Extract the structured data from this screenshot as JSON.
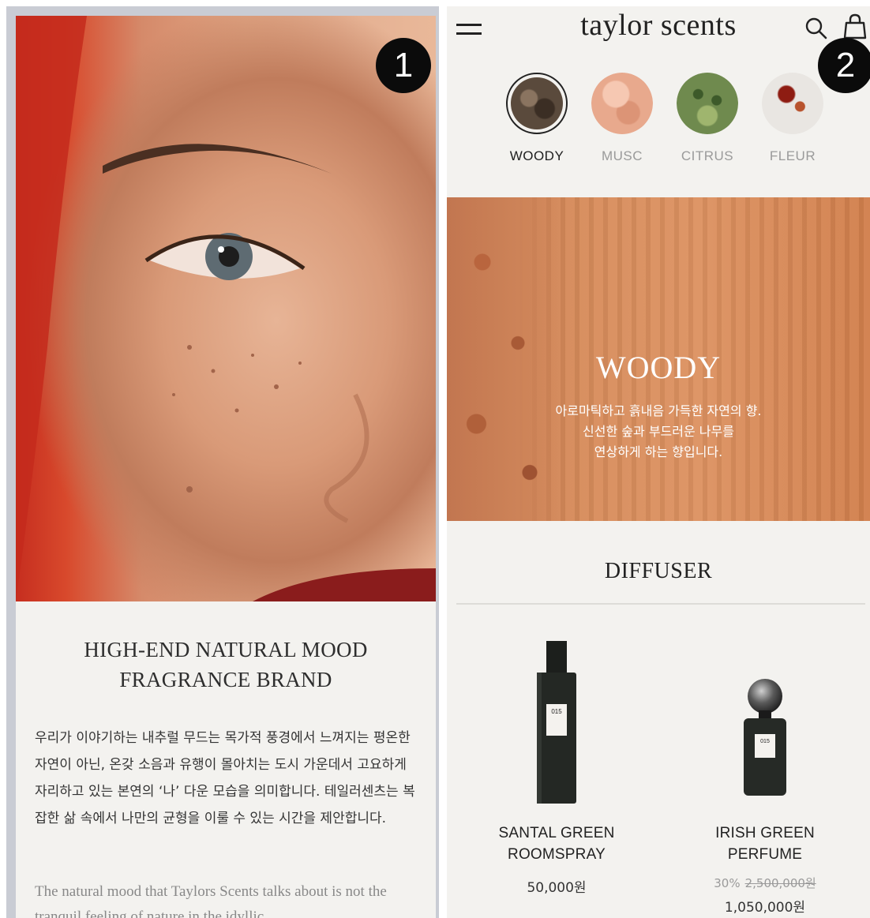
{
  "badges": {
    "first": "1",
    "second": "2"
  },
  "left": {
    "title_line1": "HIGH-END NATURAL MOOD",
    "title_line2": "FRAGRANCE BRAND",
    "body_ko": "우리가 이야기하는 내추럴 무드는 목가적 풍경에서 느껴지는 평온한 자연이 아닌, 온갖 소음과 유행이 몰아치는 도시 가운데서 고요하게 자리하고 있는 본연의 ‘나’ 다운 모습을 의미합니다. 테일러센츠는 복잡한 삶 속에서 나만의 균형을 이룰 수 있는 시간을 제안합니다.",
    "body_en": "The natural mood that Taylors Scents talks about is not the tranquil feeling of nature in the idyllic"
  },
  "header": {
    "brand": "taylor scents",
    "icons": {
      "menu": "menu-icon",
      "search": "search-icon",
      "bag": "shopping-bag-icon"
    }
  },
  "categories": [
    {
      "label": "WOODY",
      "active": true,
      "color": "#5a4a3c"
    },
    {
      "label": "MUSC",
      "active": false,
      "color": "#e8a98d"
    },
    {
      "label": "CITRUS",
      "active": false,
      "color": "#6f8a4e"
    },
    {
      "label": "FLEUR",
      "active": false,
      "color": "#e9e6e2"
    }
  ],
  "hero": {
    "title": "WOODY",
    "desc_line1": "아로마틱하고 흙내음 가득한 자연의 향.",
    "desc_line2": "신선한 숲과 부드러운 나무를",
    "desc_line3": "연상하게 하는 향입니다."
  },
  "section": {
    "title": "DIFFUSER"
  },
  "products": [
    {
      "name_line1": "SANTAL GREEN",
      "name_line2": "ROOMSPRAY",
      "price": "50,000원",
      "label": "015"
    },
    {
      "name_line1": "IRISH GREEN",
      "name_line2": "PERFUME",
      "discount": "30%",
      "original_price": "2,500,000원",
      "sale_price": "1,050,000원",
      "label": "015"
    }
  ],
  "colors": {
    "background": "#f3f2ef",
    "text": "#222222",
    "muted": "#9a9a9a",
    "hero": "#d88d5c"
  }
}
